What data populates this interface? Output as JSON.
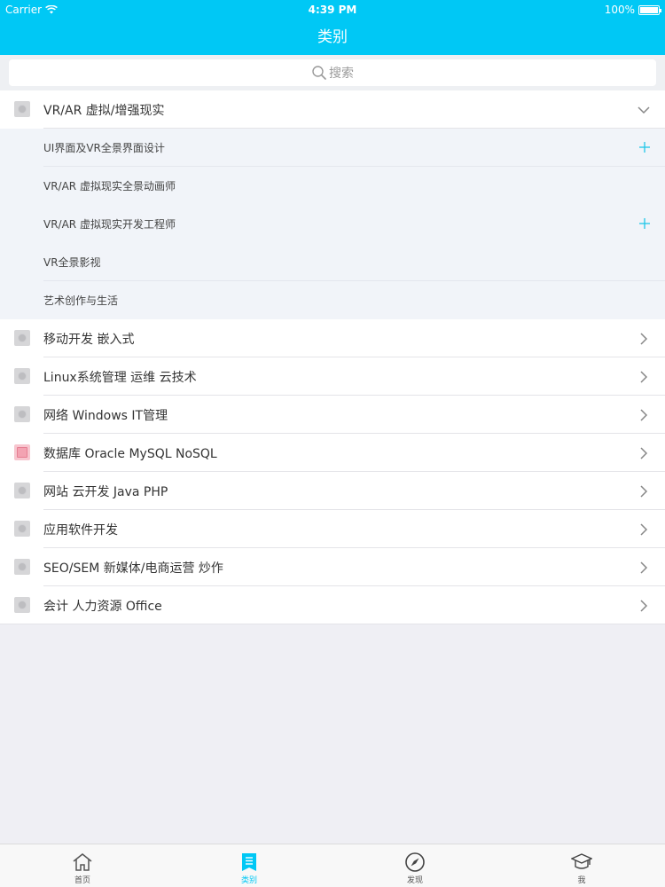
{
  "status_bar": {
    "carrier": "Carrier",
    "time": "4:39 PM",
    "battery": "100%"
  },
  "nav": {
    "title": "类别"
  },
  "search": {
    "placeholder": "搜索"
  },
  "expanded_category": {
    "label": "VR/AR 虚拟/增强现实",
    "subitems": [
      {
        "label": "UI界面及VR全景界面设计",
        "expandable": true
      },
      {
        "label": "VR/AR 虚拟现实全景动画师",
        "expandable": false
      },
      {
        "label": "VR/AR 虚拟现实开发工程师",
        "expandable": true
      },
      {
        "label": "VR全景影视",
        "expandable": false
      },
      {
        "label": "艺术创作与生活",
        "expandable": false
      }
    ]
  },
  "categories": [
    {
      "label": "移动开发 嵌入式"
    },
    {
      "label": "Linux系统管理 运维 云技术"
    },
    {
      "label": "网络 Windows IT管理"
    },
    {
      "label": "数据库 Oracle MySQL NoSQL"
    },
    {
      "label": "网站 云开发 Java PHP"
    },
    {
      "label": "应用软件开发"
    },
    {
      "label": "SEO/SEM 新媒体/电商运营 炒作"
    },
    {
      "label": "会计 人力资源 Office"
    }
  ],
  "tabs": [
    {
      "label": "首页",
      "icon": "home-icon"
    },
    {
      "label": "类别",
      "icon": "list-icon",
      "active": true
    },
    {
      "label": "发现",
      "icon": "compass-icon"
    },
    {
      "label": "我",
      "icon": "graduation-cap-icon"
    }
  ],
  "colors": {
    "accent": "#00c8f5",
    "background": "#efeff4",
    "sub_background": "#f1f4f9"
  }
}
